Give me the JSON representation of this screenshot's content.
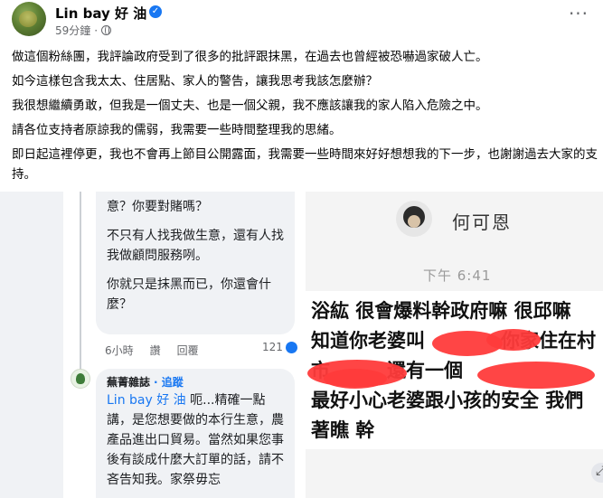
{
  "header": {
    "page_name": "Lin bay 好 油",
    "verified_icon": "verified-badge-icon",
    "time": "59分鐘",
    "privacy_icon": "globe-icon",
    "more_label": "···"
  },
  "post": {
    "paragraphs": [
      "做這個粉絲團，我評論政府受到了很多的批評跟抹黑，在過去也曾經被恐嚇過家破人亡。",
      "如今這樣包含我太太、住居點、家人的警告，讓我思考我該怎麼辦？",
      "我很想繼續勇敢，但我是一個丈夫、也是一個父親，我不應該讓我的家人陷入危險之中。",
      "請各位支持者原諒我的儒弱，我需要一些時間整理我的思緒。",
      "即日起這裡停更，我也不會再上節目公開露面，我需要一些時間來好好想想我的下一步，也謝謝過去大家的支持。"
    ]
  },
  "left_screenshot": {
    "comment1": {
      "lines": [
        "意？你要對賭嗎？",
        "不只有人找我做生意，還有人找我做顧問服務咧。",
        "你就只是抹黑而已，你還會什麼？"
      ],
      "time": "6小時",
      "like_label": "讚",
      "reply_label": "回覆",
      "reactions": "121"
    },
    "comment2": {
      "author": "蕪菁雜誌",
      "follow_label": "· 追蹤",
      "tag": "Lin bay 好 油",
      "text": " 呃...精確一點講，是您想要做的本行生意，農產品進出口貿易。當然如果您事後有談成什麼大訂單的話，請不吝告知我。家祭毋忘"
    }
  },
  "right_screenshot": {
    "sender": "何可恩",
    "time": "下午 6:41",
    "message_lines": [
      "浴紘 很會爆料幹政府嘛 很邱嘛",
      "知道你老婆叫　　　　你家住在村",
      "市　　　還有一個",
      "最好小心老婆跟小孩的安全 我們",
      "著瞧 幹"
    ]
  },
  "colors": {
    "accent": "#1877f2",
    "redaction": "#ff3b3b",
    "meta_text": "#65676b"
  }
}
